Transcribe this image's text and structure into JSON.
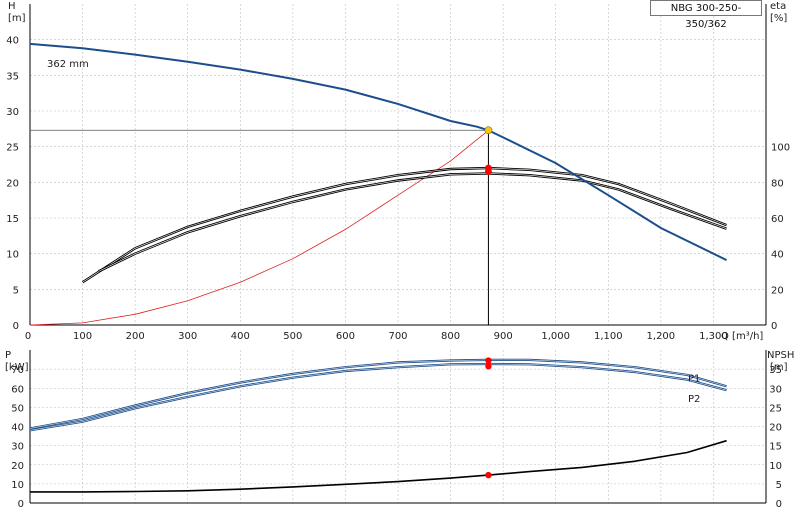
{
  "model_label": "NBG 300-250-350/362",
  "chart_data": [
    {
      "type": "line",
      "title": "",
      "xlabel": "Q [m³/h]",
      "xlim": [
        0,
        1400
      ],
      "x_ticks": [
        0,
        100,
        200,
        300,
        400,
        500,
        600,
        700,
        800,
        900,
        1000,
        1100,
        1200,
        1300
      ],
      "x_tick_labels": [
        "0",
        "100",
        "200",
        "300",
        "400",
        "500",
        "600",
        "700",
        "800",
        "900",
        "1,000",
        "1,100",
        "1,200",
        "1,300"
      ],
      "left_axis": {
        "label_line1": "H",
        "label_line2": "[m]",
        "ylim": [
          0,
          45
        ],
        "ticks": [
          0,
          5,
          10,
          15,
          20,
          25,
          30,
          35,
          40
        ]
      },
      "right_axis": {
        "label_line1": "eta",
        "label_line2": "[%]",
        "ylim": [
          0,
          180
        ],
        "ticks": [
          0,
          20,
          40,
          60,
          80,
          100
        ]
      },
      "curve_label": "362 mm",
      "operating_point": {
        "Q": 872,
        "H": 27.3,
        "eta_upper": 88,
        "eta_lower": 86
      },
      "colors": {
        "head": "#1d4e8c",
        "eta": "#000000",
        "system": "#e02020",
        "op_point": "#f5c518",
        "eta_point": "#ff0000"
      },
      "series": [
        {
          "key": "H",
          "axis": "left",
          "x": [
            0,
            100,
            200,
            300,
            400,
            500,
            600,
            700,
            800,
            850,
            872,
            900,
            1000,
            1100,
            1200,
            1325
          ],
          "y": [
            39.4,
            38.8,
            37.9,
            36.9,
            35.8,
            34.5,
            33.0,
            31.0,
            28.6,
            27.8,
            27.3,
            26.3,
            22.7,
            18.2,
            13.6,
            9.1
          ]
        },
        {
          "key": "eta_upper",
          "axis": "right",
          "x": [
            100,
            200,
            300,
            400,
            500,
            600,
            700,
            800,
            872,
            950,
            1050,
            1120,
            1220,
            1325
          ],
          "y": [
            24,
            43,
            55,
            64,
            72,
            79,
            84,
            87.5,
            88,
            87,
            84,
            79,
            68,
            56
          ]
        },
        {
          "key": "eta_lower",
          "axis": "right",
          "x": [
            130,
            200,
            300,
            400,
            500,
            600,
            700,
            800,
            872,
            950,
            1050,
            1120,
            1220,
            1325
          ],
          "y": [
            30,
            40,
            52,
            61,
            69,
            76,
            81,
            84.5,
            85,
            84,
            81,
            76,
            65,
            54
          ]
        },
        {
          "key": "system",
          "axis": "left",
          "x": [
            0,
            100,
            200,
            300,
            400,
            500,
            600,
            700,
            800,
            872
          ],
          "y": [
            0,
            0.3,
            1.5,
            3.4,
            6.0,
            9.3,
            13.4,
            18.2,
            23.0,
            27.3
          ]
        }
      ]
    },
    {
      "type": "line",
      "title": "",
      "xlim": [
        0,
        1400
      ],
      "left_axis": {
        "label_line1": "P",
        "label_line2": "[kW]",
        "ylim": [
          0,
          80
        ],
        "ticks": [
          0,
          10,
          20,
          30,
          40,
          50,
          60,
          70
        ]
      },
      "right_axis": {
        "label_line1": "NPSH",
        "label_line2": "[m]",
        "ylim": [
          0,
          40
        ],
        "ticks": [
          0,
          5,
          10,
          15,
          20,
          25,
          30,
          35
        ]
      },
      "operating_point": {
        "Q": 872,
        "P1": 74.5,
        "P2": 71.5,
        "NPSH": 7.3
      },
      "colors": {
        "power": "#1d4e8c",
        "npsh": "#000000",
        "point": "#ff0000"
      },
      "series": [
        {
          "key": "P1",
          "name": "P1",
          "axis": "left",
          "x": [
            0,
            100,
            200,
            300,
            400,
            500,
            600,
            700,
            800,
            872,
            950,
            1050,
            1150,
            1250,
            1325
          ],
          "y": [
            39,
            44,
            51,
            57.5,
            63,
            67.5,
            71,
            73.5,
            74.5,
            74.8,
            74.8,
            73.5,
            71,
            67,
            61
          ]
        },
        {
          "key": "P2",
          "name": "P2",
          "axis": "left",
          "x": [
            0,
            100,
            200,
            300,
            400,
            500,
            600,
            700,
            800,
            872,
            950,
            1050,
            1150,
            1250,
            1325
          ],
          "y": [
            38,
            42.5,
            49.5,
            55.5,
            61,
            65.5,
            69,
            71,
            72.5,
            72.7,
            72.5,
            71,
            68.5,
            64.5,
            59
          ]
        },
        {
          "key": "NPSH",
          "axis": "right",
          "x": [
            0,
            100,
            200,
            300,
            400,
            500,
            600,
            700,
            800,
            872,
            950,
            1050,
            1150,
            1250,
            1325
          ],
          "y": [
            2.9,
            2.9,
            3.0,
            3.2,
            3.6,
            4.2,
            4.9,
            5.6,
            6.5,
            7.3,
            8.2,
            9.3,
            10.9,
            13.2,
            16.3
          ]
        }
      ]
    }
  ]
}
